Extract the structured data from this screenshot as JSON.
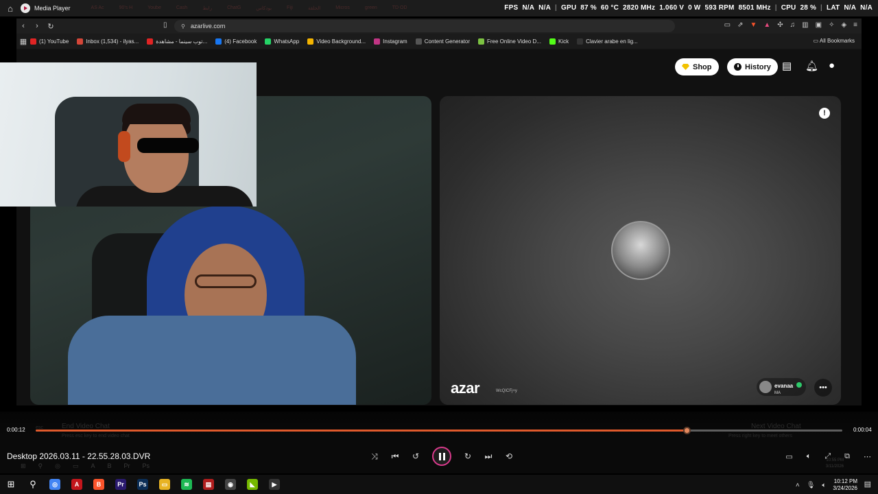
{
  "media_player": {
    "title": "Media Player",
    "ghost_tabs": [
      "AS Ac",
      "90's H",
      "Yoube",
      "Cash",
      "رابط",
      "ChatG",
      "بودكاس",
      "Fiji",
      "الحلقة",
      "Micros",
      "green",
      "TD OD"
    ],
    "hud": {
      "fps_label": "FPS",
      "fps_v1": "N/A",
      "fps_v2": "N/A",
      "gpu_label": "GPU",
      "gpu_load": "87 %",
      "gpu_temp": "60 °C",
      "gpu_clock": "2820 MHz",
      "gpu_volt": "1.060 V",
      "gpu_power": "0 W",
      "gpu_fan": "593 RPM",
      "gpu_mem": "8501 MHz",
      "cpu_label": "CPU",
      "cpu_load": "28 %",
      "lat_label": "LAT",
      "lat_v1": "N/A",
      "lat_v2": "N/A"
    }
  },
  "browser": {
    "url": "azarlive.com",
    "bookmarks": [
      {
        "label": "(1) YouTube",
        "color": "#e02424"
      },
      {
        "label": "Inbox (1,534) - ilyas...",
        "color": "#d44638"
      },
      {
        "label": "توب سينما - مشاهدة...",
        "color": "#e02424"
      },
      {
        "label": "(4) Facebook",
        "color": "#1877f2"
      },
      {
        "label": "WhatsApp",
        "color": "#25d366"
      },
      {
        "label": "Video Background...",
        "color": "#f4b400"
      },
      {
        "label": "Instagram",
        "color": "#c13584"
      },
      {
        "label": "Content Generator",
        "color": "#555555"
      },
      {
        "label": "Free Online Video D...",
        "color": "#7cc242"
      },
      {
        "label": "Kick",
        "color": "#53fc18"
      },
      {
        "label": "Clavier arabe en lig...",
        "color": "#333333"
      }
    ],
    "all_bookmarks": "All Bookmarks"
  },
  "azar": {
    "shop_label": "Shop",
    "history_label": "History",
    "logo": "azar",
    "stream_id": "WcQICFj+y",
    "partner": {
      "name": "evanaa",
      "country": "MA"
    },
    "report_symbol": "!"
  },
  "player": {
    "elapsed": "0:00:12",
    "remaining": "0:00:04",
    "progress": 0.807,
    "filename": "Desktop 2026.03.11 - 22.55.28.03.DVR",
    "ghost_end": "End Video Chat",
    "ghost_end_hint": "Press esc key to end video chat",
    "ghost_esc": "esc",
    "ghost_next": "Next Video Chat",
    "ghost_next_hint": "Press right key to meet others",
    "ghost_time": "10:55 PM",
    "ghost_date": "3/11/2026"
  },
  "taskbar": {
    "time": "10:12 PM",
    "date": "3/24/2026",
    "apps": [
      {
        "name": "chrome",
        "color": "#4285f4",
        "glyph": "◎"
      },
      {
        "name": "acrobat",
        "color": "#c4161c",
        "glyph": "A"
      },
      {
        "name": "brave",
        "color": "#fb542b",
        "glyph": "B"
      },
      {
        "name": "premiere",
        "color": "#2a1a6e",
        "glyph": "Pr"
      },
      {
        "name": "photoshop",
        "color": "#0b2e57",
        "glyph": "Ps"
      },
      {
        "name": "explorer",
        "color": "#e8b323",
        "glyph": "▭"
      },
      {
        "name": "spotify",
        "color": "#1db954",
        "glyph": "≋"
      },
      {
        "name": "video-editor",
        "color": "#b11e1e",
        "glyph": "▤"
      },
      {
        "name": "recorder",
        "color": "#444444",
        "glyph": "◉"
      },
      {
        "name": "nvidia",
        "color": "#76b900",
        "glyph": "◣"
      },
      {
        "name": "media-player",
        "color": "#333333",
        "glyph": "▶"
      }
    ]
  }
}
